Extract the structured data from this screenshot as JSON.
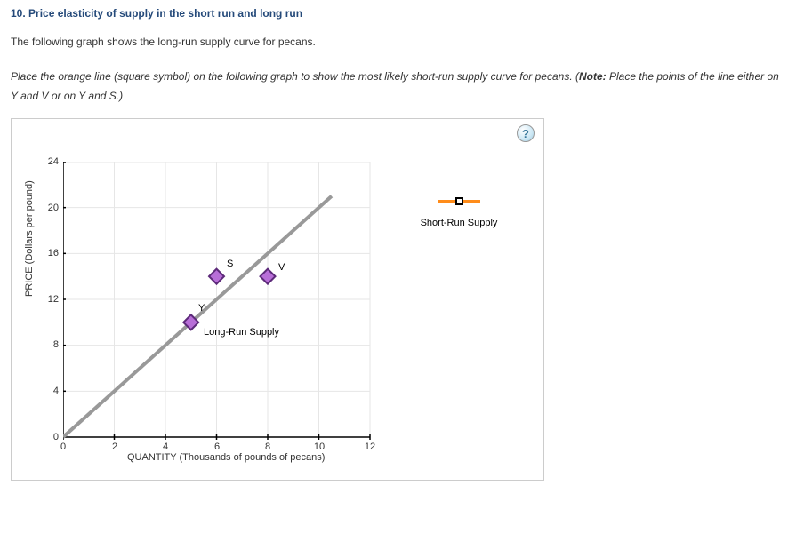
{
  "title": "10. Price elasticity of supply in the short run and long run",
  "intro": "The following graph shows the long-run supply curve for pecans.",
  "instruction_pre": "Place the orange line (square symbol) on the following graph to show the most likely short-run supply curve for pecans. (",
  "instruction_note_label": "Note:",
  "instruction_post": " Place the points of the line either on Y and V or on Y and S.)",
  "help_glyph": "?",
  "legend": {
    "short_run": "Short-Run Supply"
  },
  "chart_data": {
    "type": "line",
    "xlabel": "QUANTITY (Thousands of pounds of pecans)",
    "ylabel": "PRICE (Dollars per pound)",
    "xlim": [
      0,
      12
    ],
    "ylim": [
      0,
      24
    ],
    "x_ticks": [
      0,
      2,
      4,
      6,
      8,
      10,
      12
    ],
    "y_ticks": [
      0,
      4,
      8,
      12,
      16,
      20,
      24
    ],
    "series": [
      {
        "name": "Long-Run Supply",
        "x": [
          0,
          10.5
        ],
        "y": [
          0,
          21
        ],
        "color": "#999999"
      }
    ],
    "points": [
      {
        "label": "Y",
        "x": 5,
        "y": 10
      },
      {
        "label": "S",
        "x": 6,
        "y": 14
      },
      {
        "label": "V",
        "x": 8,
        "y": 14
      }
    ],
    "curve_label": "Long-Run Supply",
    "draggable_item": "Short-Run Supply"
  }
}
